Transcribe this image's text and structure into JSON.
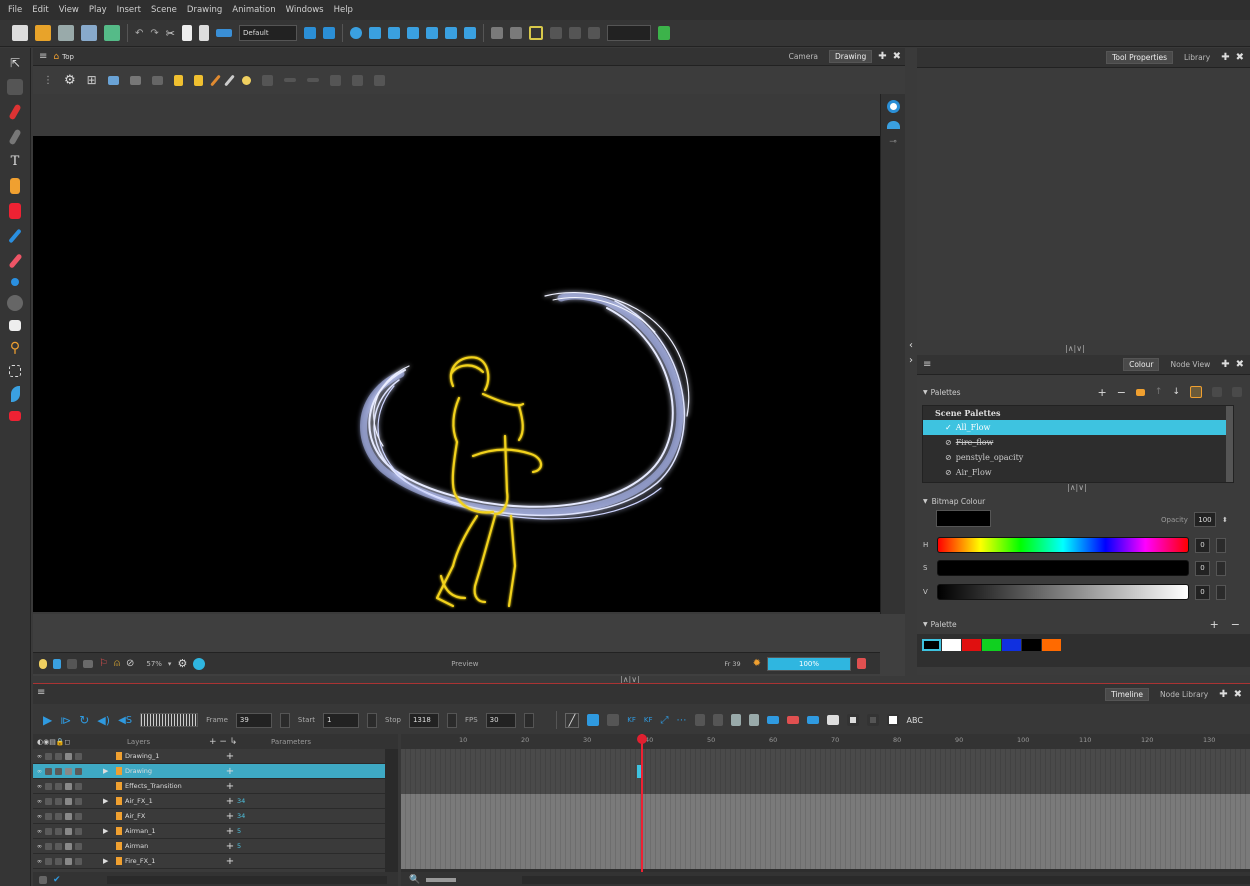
{
  "menu": [
    "File",
    "Edit",
    "View",
    "Play",
    "Insert",
    "Scene",
    "Drawing",
    "Animation",
    "Windows",
    "Help"
  ],
  "main_toolbar": {
    "preset_combo": "Default"
  },
  "camera_view": {
    "tab_title": "Top",
    "tabs": [
      "Camera",
      "Drawing"
    ],
    "zoom": "57%",
    "status_label": "Preview",
    "frame_readout": "Fr 39",
    "progress_label": "100%",
    "progress_fraction": 1.0
  },
  "tool_panel": {
    "tabs": [
      "Tool Properties",
      "Library"
    ]
  },
  "colour_panel": {
    "tabs": [
      "Colour",
      "Node View"
    ],
    "palettes_header": "Palettes",
    "scene_palettes_title": "Scene Palettes",
    "palettes": [
      {
        "name": "All_Flow",
        "selected": true,
        "mark": "✓"
      },
      {
        "name": "Fire_flow",
        "selected": false,
        "mark": "⊘"
      },
      {
        "name": "penstyle_opacity",
        "selected": false,
        "mark": "⊘"
      },
      {
        "name": "Air_Flow",
        "selected": false,
        "mark": "⊘"
      }
    ],
    "bitmap_header": "Bitmap Colour",
    "opacity_label": "Opacity",
    "opacity_value": "100",
    "sliders": [
      {
        "label": "H",
        "value": "0"
      },
      {
        "label": "S",
        "value": "0"
      },
      {
        "label": "V",
        "value": "0"
      }
    ],
    "palette_header": "Palette",
    "swatches": [
      "#000000",
      "#ffffff",
      "#e01010",
      "#10d020",
      "#1030e0",
      "#000000",
      "#ff6a00"
    ]
  },
  "timeline": {
    "tabs": [
      "Timeline",
      "Node Library"
    ],
    "frame_label": "Frame",
    "frame_value": "39",
    "start_label": "Start",
    "start_value": "1",
    "stop_label": "Stop",
    "stop_value": "1318",
    "fps_label": "FPS",
    "fps_value": "30",
    "layers_header": "Layers",
    "params_header": "Parameters",
    "ruler_ticks": [
      "10",
      "20",
      "30",
      "40",
      "50",
      "60",
      "70",
      "80",
      "90",
      "100",
      "110",
      "120",
      "130"
    ],
    "layers": [
      {
        "name": "Drawing_1",
        "param": "",
        "expand": false,
        "selected": false,
        "filled": false
      },
      {
        "name": "Drawing",
        "param": "",
        "expand": true,
        "selected": true,
        "filled": false
      },
      {
        "name": "Effects_Transition",
        "param": "",
        "expand": false,
        "selected": false,
        "filled": false
      },
      {
        "name": "Air_FX_1",
        "param": "34",
        "expand": true,
        "selected": false,
        "filled": true
      },
      {
        "name": "Air_FX",
        "param": "34",
        "expand": false,
        "selected": false,
        "filled": true
      },
      {
        "name": "Airman_1",
        "param": "5",
        "expand": true,
        "selected": false,
        "filled": true
      },
      {
        "name": "Airman",
        "param": "5",
        "expand": false,
        "selected": false,
        "filled": true
      },
      {
        "name": "Fire_FX_1",
        "param": "",
        "expand": true,
        "selected": false,
        "filled": true
      }
    ]
  },
  "colors": {
    "accent": "#3ec3e0",
    "playhead": "#e02030",
    "figure_stroke": "#f2d21a",
    "swirl": "#c8d0ff"
  }
}
